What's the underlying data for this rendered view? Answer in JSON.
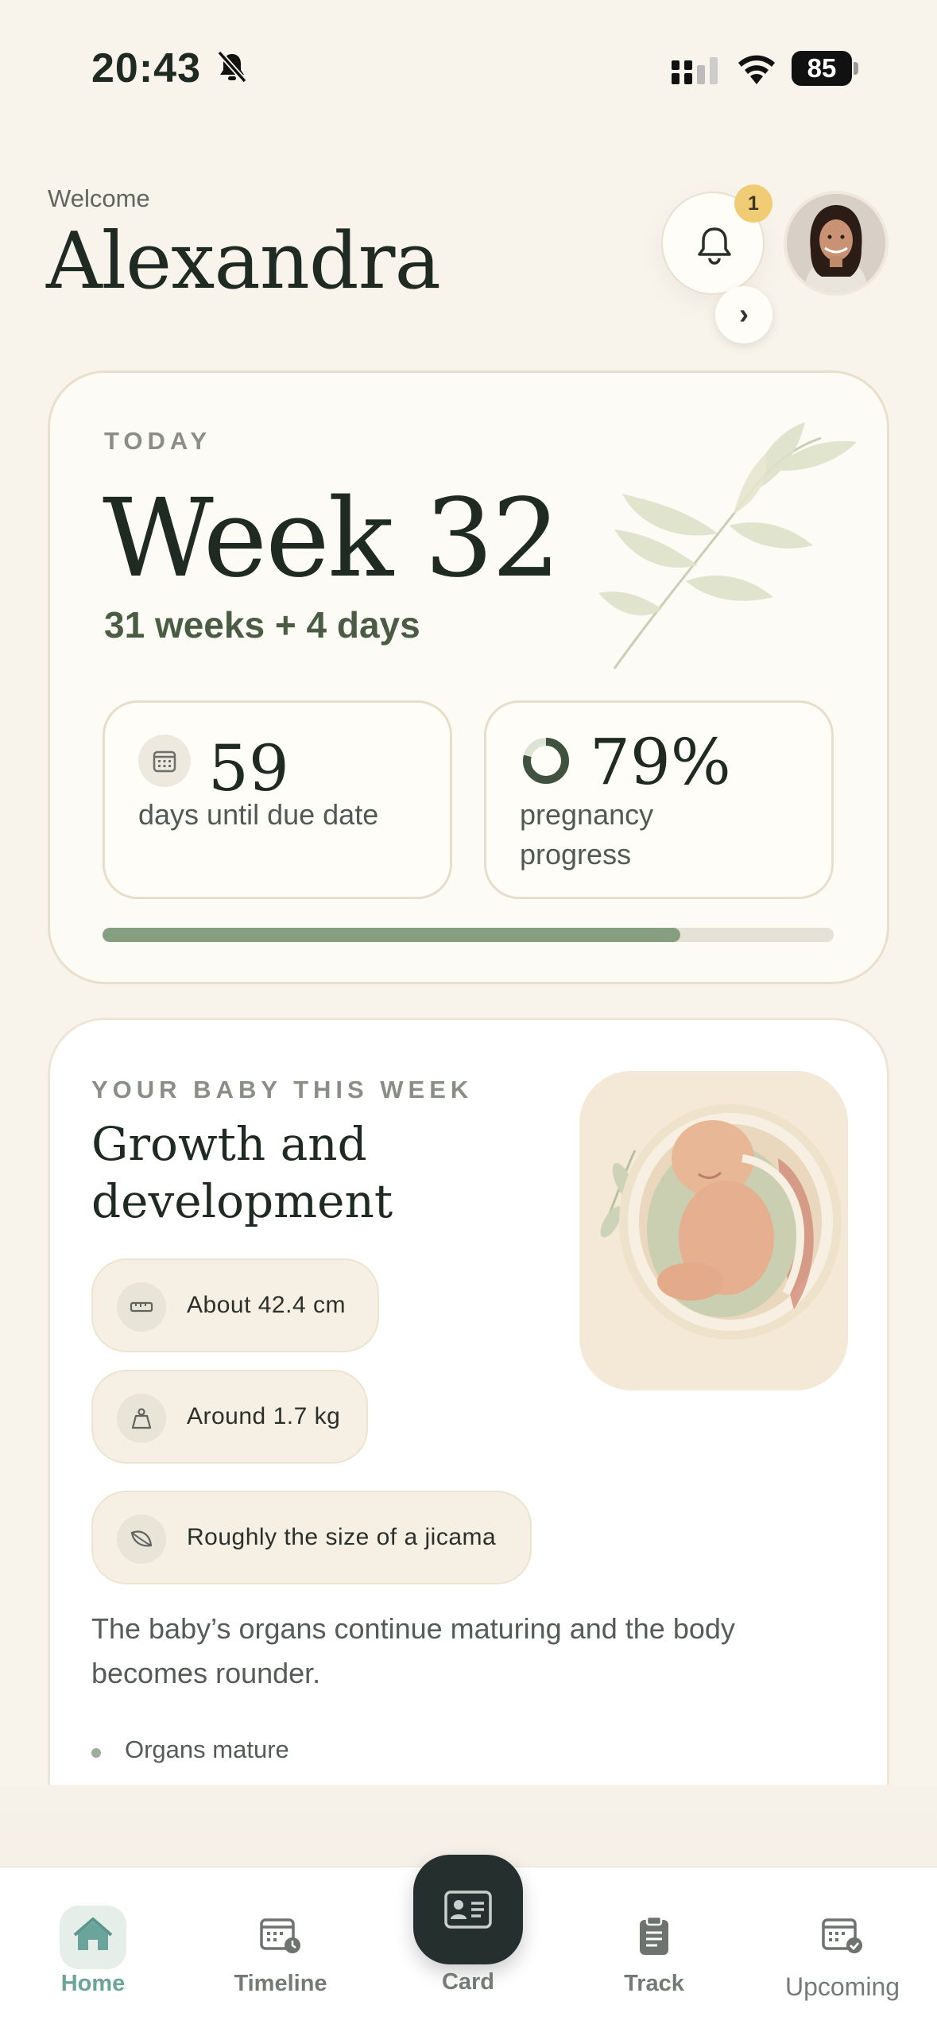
{
  "status_bar": {
    "time": "20:43",
    "battery": "85"
  },
  "header": {
    "welcome": "Welcome",
    "name": "Alexandra",
    "notification_count": "1"
  },
  "week_card": {
    "today_label": "TODAY",
    "week_title": "Week 32",
    "week_sub": "31 weeks + 4 days",
    "days_until_due": "59",
    "days_label": "days until due date",
    "progress_value": "79%",
    "progress_label": "pregnancy progress",
    "progress_fraction": 0.79
  },
  "baby_card": {
    "eyebrow": "YOUR BABY THIS WEEK",
    "title": "Growth and development",
    "chips": [
      {
        "icon": "ruler-icon",
        "text": "About 42.4 cm"
      },
      {
        "icon": "weight-icon",
        "text": "Around 1.7 kg"
      },
      {
        "icon": "leaf-icon",
        "text": "Roughly the size of a jicama"
      }
    ],
    "description": "The baby’s organs continue maturing and the body becomes rounder.",
    "bullets": [
      "Organs mature"
    ],
    "arrow": "›"
  },
  "tabs": [
    {
      "label": "Home",
      "icon": "home-icon"
    },
    {
      "label": "Timeline",
      "icon": "calendar-clock-icon"
    },
    {
      "label": "Card",
      "icon": "id-card-icon"
    },
    {
      "label": "Track",
      "icon": "clipboard-icon"
    },
    {
      "label": "Upcoming",
      "icon": "calendar-check-icon"
    }
  ],
  "colors": {
    "background": "#f8f4ec",
    "accent_green": "#4a5c44",
    "progress": "#869e80",
    "badge": "#f0cd75",
    "home_active": "#6aa49b",
    "card_button": "#25302e"
  }
}
